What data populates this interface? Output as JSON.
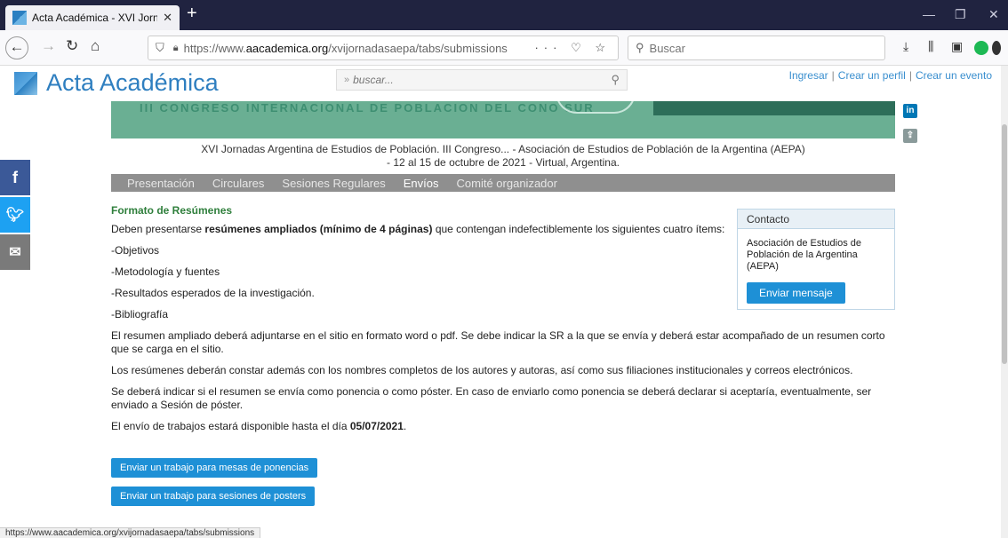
{
  "browser": {
    "tab_title": "Acta Académica - XVI Jornadas",
    "tab_close": "✕",
    "new_tab": "+",
    "url_prefix": "https://www.",
    "url_domain": "aacademica.org",
    "url_path": "/xvijornadasaepa/tabs/submissions",
    "search_placeholder": "Buscar",
    "status_url": "https://www.aacademica.org/xvijornadasaepa/tabs/submissions"
  },
  "site": {
    "logo_text": "Acta Académica",
    "search_placeholder": "buscar...",
    "links": [
      "Ingresar",
      "Crear un perfil",
      "Crear un evento"
    ]
  },
  "banner": {
    "text": "III CONGRESO INTERNACIONAL DE POBLACION DEL CONO SUR"
  },
  "event": {
    "line1": "XVI Jornadas Argentina de Estudios de Población. III Congreso... - Asociación de Estudios de Población de la Argentina (AEPA)",
    "line2": "- 12 al 15 de octubre de 2021 - Virtual, Argentina."
  },
  "menu": [
    "Presentación",
    "Circulares",
    "Sesiones Regulares",
    "Envíos",
    "Comité organizador"
  ],
  "content": {
    "title": "Formato de Resúmenes",
    "intro_a": "Deben presentarse ",
    "intro_bold": "resúmenes ampliados (mínimo de 4 páginas)",
    "intro_b": " que contengan indefectiblemente los siguientes cuatro ítems:",
    "items": [
      "-Objetivos",
      "-Metodología y fuentes",
      "-Resultados esperados de la investigación.",
      "-Bibliografía"
    ],
    "p1": "El resumen ampliado deberá adjuntarse en el sitio en formato word o pdf. Se debe indicar la SR a la que se envía y deberá estar acompañado de un resumen corto que se carga en el sitio.",
    "p2": "Los resúmenes deberán constar además con los nombres completos de los autores y autoras, así como sus filiaciones institucionales y correos electrónicos.",
    "p3": "Se deberá indicar si el resumen se envía como ponencia o como póster. En caso de enviarlo como ponencia se deberá declarar si aceptaría, eventualmente, ser enviado a Sesión de póster.",
    "deadline_text": "El envío de trabajos estará disponible hasta el día ",
    "deadline_date": "05/07/2021",
    "deadline_end": ".",
    "btn_ponencias": "Enviar un trabajo para mesas de ponencias",
    "btn_posters": "Enviar un trabajo para sesiones de posters"
  },
  "contact": {
    "header": "Contacto",
    "org": "Asociación de Estudios de Población de la Argentina (AEPA)",
    "button": "Enviar mensaje"
  },
  "social": {
    "facebook": "f",
    "twitter": "t",
    "email": "✉",
    "linkedin": "in"
  },
  "colors": {
    "accent": "#1e90d6",
    "menu_bg": "#8f8f8f",
    "title_green": "#2f7f3c",
    "banner": "#6aaf93",
    "facebook": "#3b5998",
    "twitter": "#1da1f2",
    "email": "#7a7a7a",
    "linkedin": "#0077b5"
  }
}
